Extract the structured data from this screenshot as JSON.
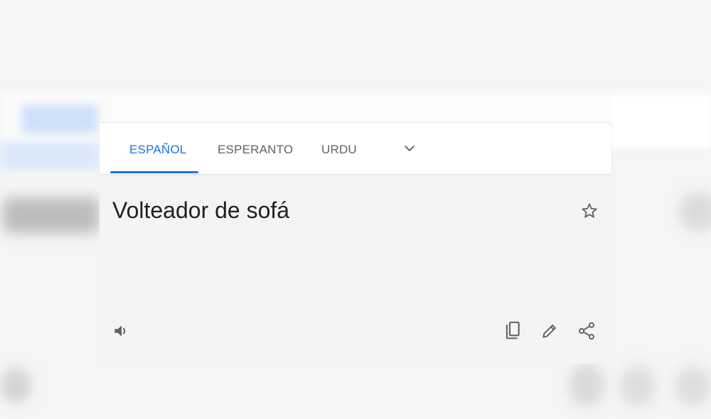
{
  "translation_panel": {
    "tabs": [
      {
        "label": "ESPAÑOL",
        "active": true
      },
      {
        "label": "ESPERANTO",
        "active": false
      },
      {
        "label": "URDU",
        "active": false
      }
    ],
    "more_languages_icon": "chevron-down-icon",
    "translated_text": "Volteador de sofá",
    "icons": {
      "star": "star-outline-icon",
      "listen": "speaker-icon",
      "copy": "copy-icon",
      "edit": "pencil-icon",
      "share": "share-icon"
    }
  },
  "colors": {
    "accent": "#1a73e8",
    "text_primary": "#202124",
    "text_secondary": "#5f6368",
    "icon": "#5f6368",
    "background": "#f5f5f5",
    "tab_bar": "#ffffff"
  }
}
